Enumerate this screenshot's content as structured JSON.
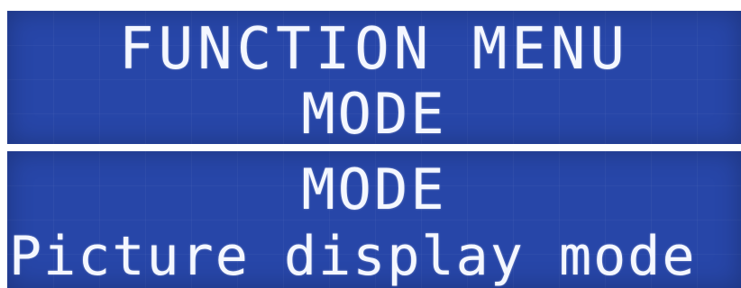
{
  "screens": [
    {
      "line1": "FUNCTION MENU",
      "line2": "MODE"
    },
    {
      "line1": "MODE",
      "line2": "Picture display mode"
    }
  ],
  "colors": {
    "background": "#2746a8",
    "text": "#f4f7ff"
  }
}
